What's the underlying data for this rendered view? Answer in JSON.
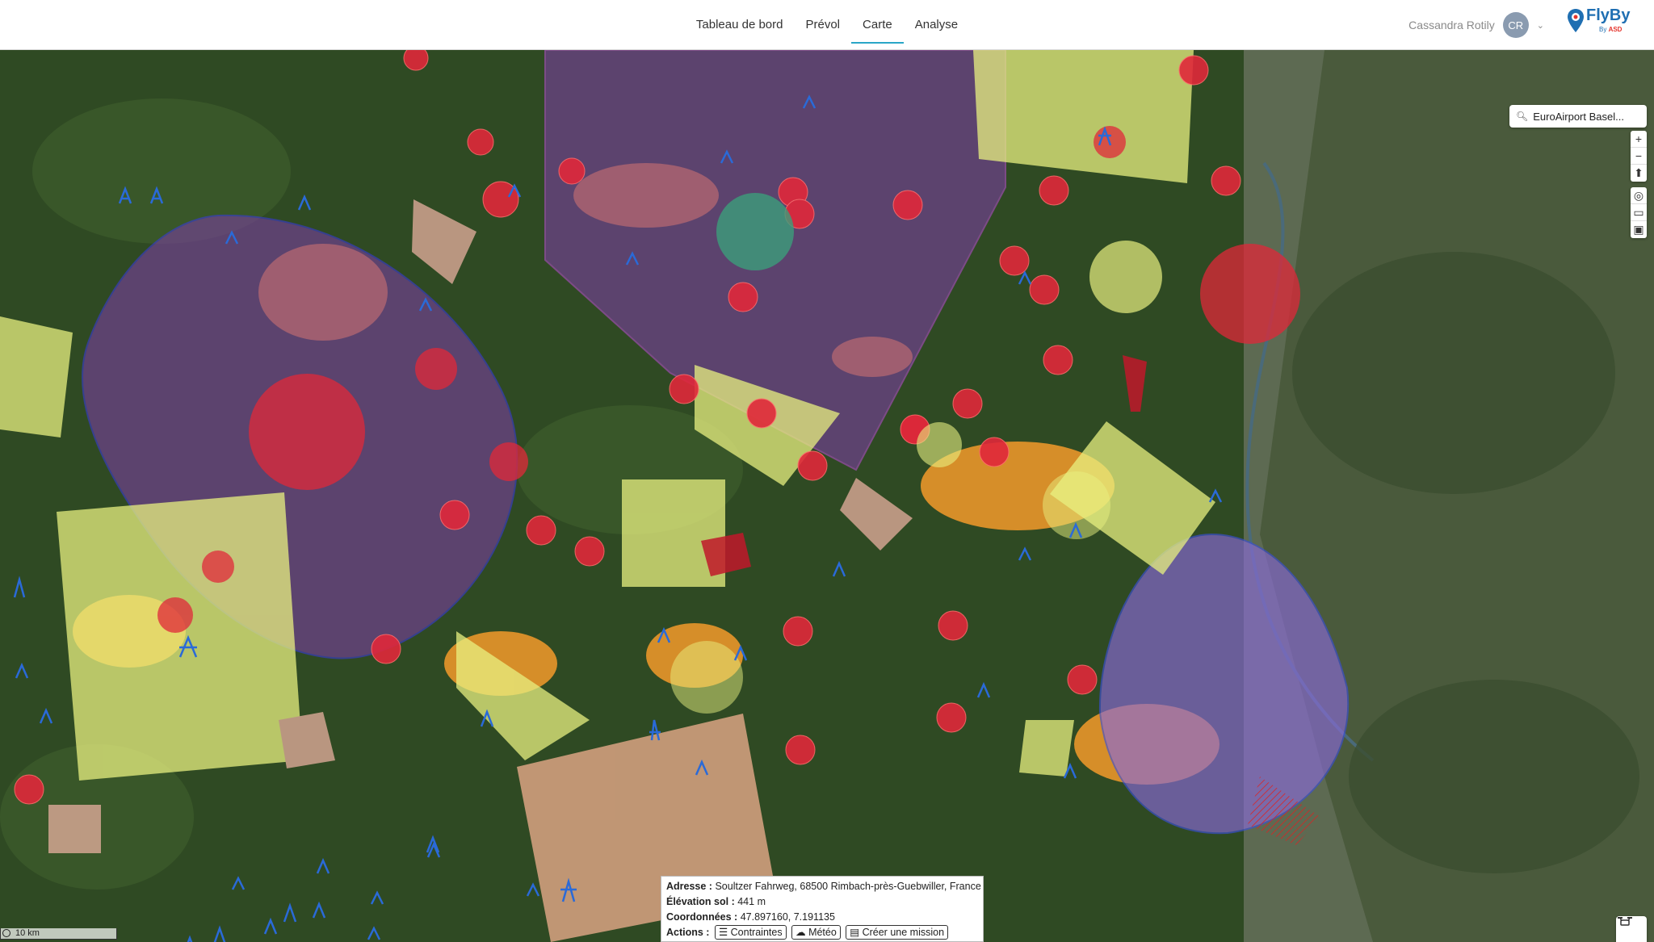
{
  "nav": {
    "tabs": [
      {
        "label": "Tableau de bord"
      },
      {
        "label": "Prévol"
      },
      {
        "label": "Carte"
      },
      {
        "label": "Analyse"
      }
    ],
    "active_tab": "Carte"
  },
  "user": {
    "name": "Cassandra Rotily",
    "initials": "CR"
  },
  "logo": {
    "text": "FlyBy",
    "sub_by": "By ",
    "sub_brand": "ASD"
  },
  "search": {
    "value": "EuroAirport Basel..."
  },
  "map_controls": {
    "zoom_in": "+",
    "zoom_out": "−",
    "compass": "⬆",
    "locate": "◎",
    "measure": "▭",
    "print": "▣"
  },
  "scale": {
    "label": "10 km"
  },
  "popup": {
    "address_label": "Adresse :",
    "address_value": "Soultzer Fahrweg, 68500 Rimbach-près-Guebwiller, France",
    "elevation_label": "Élévation sol :",
    "elevation_value": "441 m",
    "coords_label": "Coordonnées :",
    "coords_value": "47.897160, 7.191135",
    "actions_label": "Actions :",
    "action_constraints": "Contraintes",
    "action_weather": "Météo",
    "action_mission": "Créer une mission"
  },
  "colors": {
    "accent": "#2aa6c7",
    "zone_red": "#e0283a",
    "zone_purple": "#7b3fa0",
    "zone_yellow": "#e8f080",
    "zone_orange": "#f39a2a",
    "zone_blue": "#3a4fd8",
    "map_green": "#2f4a23"
  }
}
